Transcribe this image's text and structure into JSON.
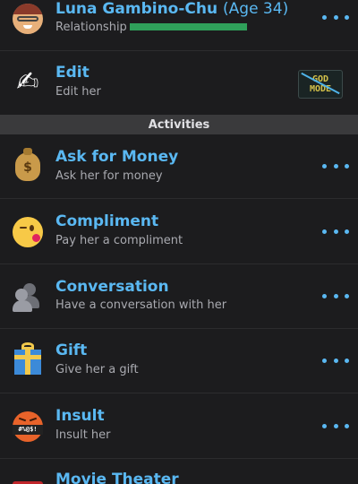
{
  "header": {
    "name": "Luna Gambino-Chu",
    "age_label": "(Age 34)",
    "relationship_label": "Relationship",
    "relationship_level": 1.0,
    "avatar_icon": "woman-avatar-icon"
  },
  "edit": {
    "title": "Edit",
    "subtitle": "Edit her",
    "icon": "writing-hand-icon",
    "badge_line1": "GOD",
    "badge_line2": "MODE"
  },
  "section": {
    "title": "Activities"
  },
  "activities": [
    {
      "title": "Ask for Money",
      "subtitle": "Ask her for money",
      "icon": "money-bag-icon"
    },
    {
      "title": "Compliment",
      "subtitle": "Pay her a compliment",
      "icon": "kissing-face-icon"
    },
    {
      "title": "Conversation",
      "subtitle": "Have a conversation with her",
      "icon": "people-icon"
    },
    {
      "title": "Gift",
      "subtitle": "Give her a gift",
      "icon": "gift-icon"
    },
    {
      "title": "Insult",
      "subtitle": "Insult her",
      "icon": "cursing-face-icon"
    },
    {
      "title": "Movie Theater",
      "subtitle": "",
      "icon": "theater-icon"
    }
  ],
  "colors": {
    "background": "#1c1c1e",
    "accent": "#5ab8f2",
    "relationship_bar": "#2fa05a",
    "section_header": "#3a3a3c"
  }
}
